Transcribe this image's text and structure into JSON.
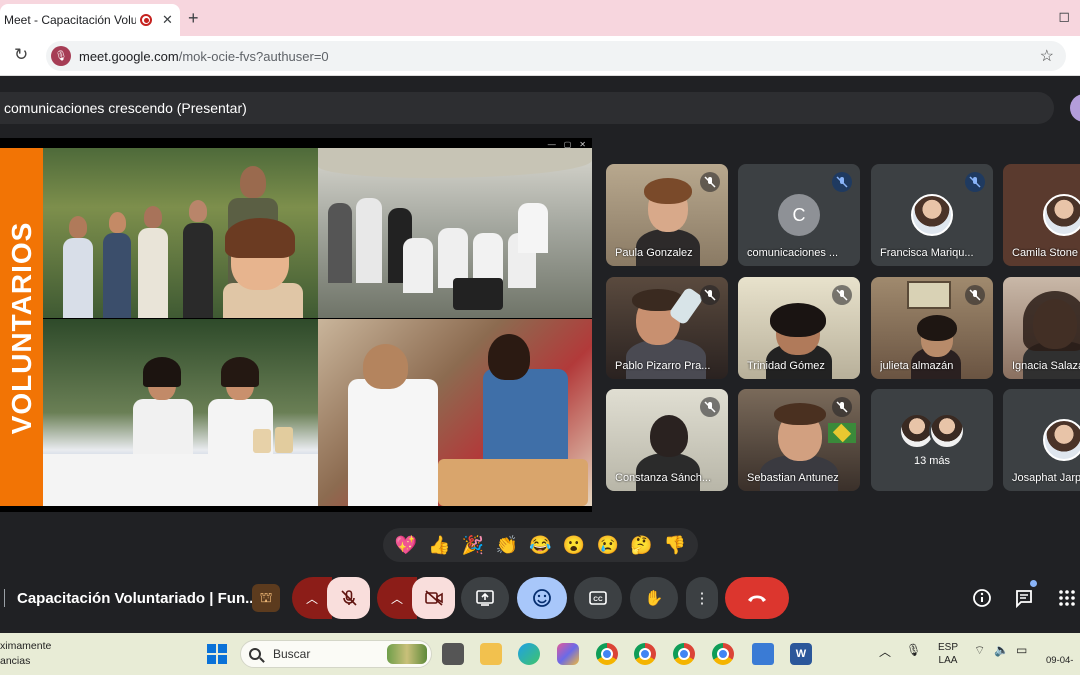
{
  "browser": {
    "tab_title": "Meet - Capacitación Voluntariado",
    "tab_close": "✕",
    "new_tab": "+",
    "url_host": "meet.google.com",
    "url_path": "/mok-ocie-fvs?authuser=0"
  },
  "meet": {
    "presenting_banner": "comunicaciones crescendo (Presentar)",
    "slide_vertical_text": "VOLUNTARIOS",
    "meeting_title": "Capacitación Voluntariado | Fun...",
    "participants": [
      {
        "name": "Paula Gonzalez",
        "muted": true
      },
      {
        "name": "comunicaciones ...",
        "muted": true,
        "initial": "C"
      },
      {
        "name": "Francisca Mariqu...",
        "muted": true
      },
      {
        "name": "Camila Stone"
      },
      {
        "name": "Pablo Pizarro Pra...",
        "muted": true
      },
      {
        "name": "Trinidad Gómez",
        "muted": true
      },
      {
        "name": "julieta almazán",
        "muted": true
      },
      {
        "name": "Ignacia Salaza"
      },
      {
        "name": "Constanza Sánch...",
        "muted": true
      },
      {
        "name": "Sebastian Antunez",
        "muted": true
      },
      {
        "name": "Josaphat Jarp"
      }
    ],
    "more_participants": "13 más",
    "reactions": [
      "💖",
      "👍",
      "🎉",
      "👏",
      "😂",
      "😮",
      "😢",
      "🤔",
      "👎"
    ]
  },
  "taskbar": {
    "weather_line1": "ximamente",
    "weather_line2": "ancias",
    "search_placeholder": "Buscar",
    "lang_line1": "ESP",
    "lang_line2": "LAA",
    "date": "09-04-"
  },
  "colors": {
    "meet_bg": "#202124",
    "end_call": "#dc362e",
    "mic_off_bg": "#f9dedc",
    "reactions_active": "#a8c7fa",
    "slide_orange": "#f27405",
    "tabbar": "#f7d6de"
  }
}
